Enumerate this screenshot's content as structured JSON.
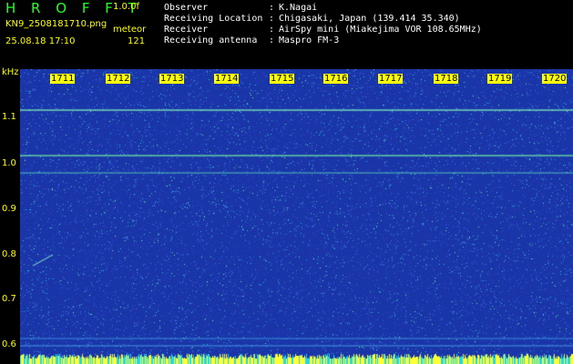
{
  "app": {
    "title": "H R O F F T",
    "version": "1.0.0f"
  },
  "file": {
    "name": "KN9_2508181710.png",
    "datetime": "25.08.18 17:10"
  },
  "meteor": {
    "label": "meteor",
    "count": "121"
  },
  "info": [
    {
      "label": "Observer",
      "sep": ":",
      "value": "K.Nagai"
    },
    {
      "label": "Receiving Location",
      "sep": ":",
      "value": "Chigasaki, Japan (139.414 35.340)"
    },
    {
      "label": "Receiver",
      "sep": ":",
      "value": "AirSpy mini (Miakejima VOR 108.65MHz)"
    },
    {
      "label": "Receiving antenna",
      "sep": ":",
      "value": "Maspro FM-3"
    }
  ],
  "waterfall": {
    "y_unit": "kHz",
    "y_ticks": [
      "1.1",
      "1.0",
      "0.9",
      "0.8",
      "0.7",
      "0.6"
    ],
    "time_labels": [
      "1711",
      "1712",
      "1713",
      "1714",
      "1715",
      "1716",
      "1717",
      "1718",
      "1719",
      "1720"
    ]
  },
  "colors": {
    "background": "#1a35a8",
    "noise": [
      "#2a4fd0",
      "#3c78e0",
      "#22c8c8",
      "#6fe8a0",
      "#1238b8"
    ],
    "label": "#ffff00",
    "title": "#22ff22"
  }
}
